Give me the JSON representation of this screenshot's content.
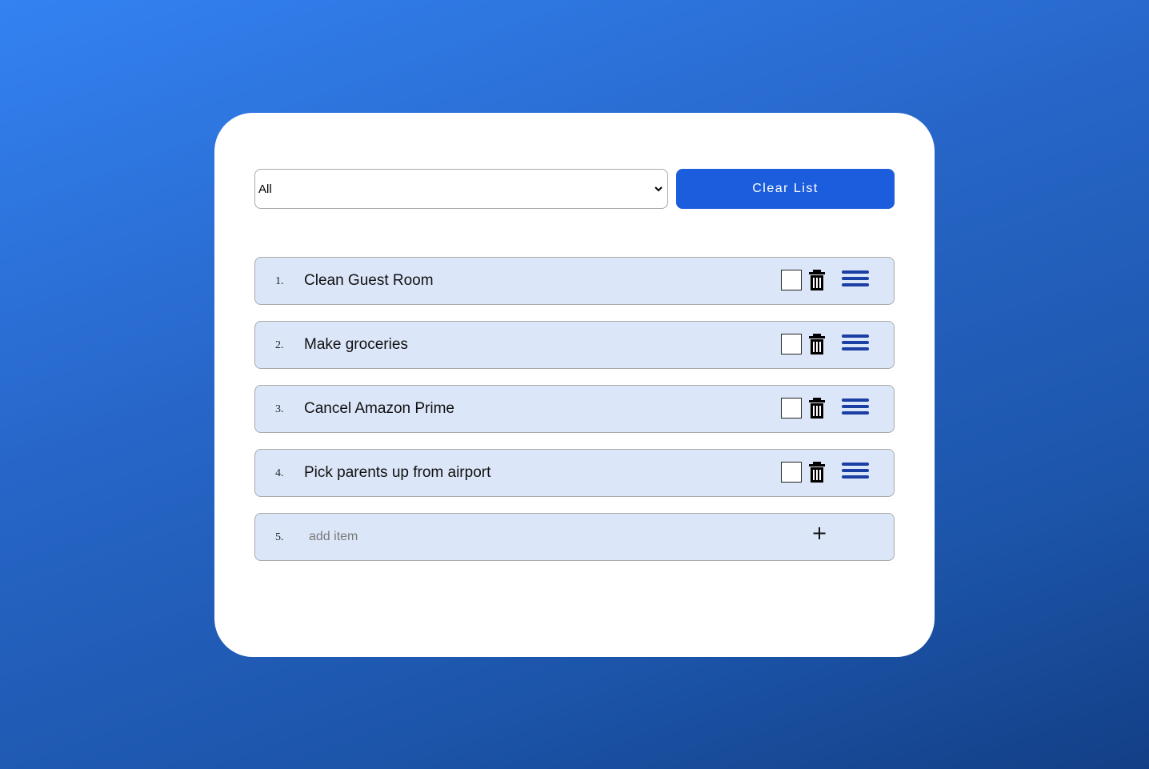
{
  "filter": {
    "selected": "All",
    "icon": "chevron-down-icon"
  },
  "toolbar": {
    "clear_label": "Clear List"
  },
  "items": [
    {
      "number": "1.",
      "text": "Clean Guest Room",
      "checked": false
    },
    {
      "number": "2.",
      "text": "Make groceries",
      "checked": false
    },
    {
      "number": "3.",
      "text": "Cancel Amazon Prime",
      "checked": false
    },
    {
      "number": "4.",
      "text": "Pick parents up from airport",
      "checked": false
    }
  ],
  "add_row": {
    "number": "5.",
    "placeholder": "add item",
    "plus_symbol": "+"
  },
  "colors": {
    "accent": "#1c5ddd",
    "row_background": "#dce6f9",
    "drag_handle": "#1a3fa3"
  }
}
